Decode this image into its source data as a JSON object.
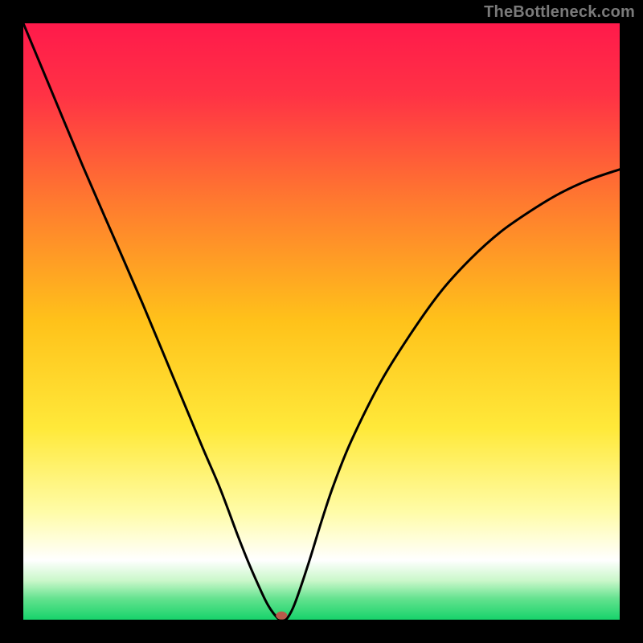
{
  "watermark": "TheBottleneck.com",
  "chart_data": {
    "type": "line",
    "title": "",
    "xlabel": "",
    "ylabel": "",
    "xlim": [
      0,
      100
    ],
    "ylim": [
      0,
      100
    ],
    "grid": false,
    "legend": false,
    "curve": {
      "description": "V-shaped bottleneck curve with minimum around x≈43; left branch steeper, right branch convex and shallower.",
      "x": [
        0,
        5,
        10,
        15,
        20,
        25,
        30,
        33,
        36,
        38,
        40,
        41,
        42,
        43,
        44,
        45,
        46,
        48,
        50,
        52,
        55,
        60,
        65,
        70,
        75,
        80,
        85,
        90,
        95,
        100
      ],
      "y": [
        100,
        88,
        76,
        64.5,
        53,
        41,
        29,
        22,
        14,
        9,
        4.5,
        2.5,
        1,
        0,
        0,
        1.5,
        4,
        10,
        16.5,
        22.5,
        30,
        40,
        48,
        55,
        60.5,
        65,
        68.5,
        71.5,
        73.8,
        75.5
      ]
    },
    "marker": {
      "x": 43.3,
      "y": 0.7,
      "color": "#b85a4a",
      "rx": 7,
      "ry": 5
    },
    "gradient_stops": [
      {
        "offset": 0.0,
        "color": "#ff1a4b"
      },
      {
        "offset": 0.12,
        "color": "#ff3245"
      },
      {
        "offset": 0.3,
        "color": "#ff7a2f"
      },
      {
        "offset": 0.5,
        "color": "#ffc21a"
      },
      {
        "offset": 0.68,
        "color": "#ffe93a"
      },
      {
        "offset": 0.82,
        "color": "#fffca8"
      },
      {
        "offset": 0.9,
        "color": "#ffffff"
      },
      {
        "offset": 0.935,
        "color": "#c9f7c9"
      },
      {
        "offset": 0.965,
        "color": "#63e28e"
      },
      {
        "offset": 1.0,
        "color": "#17d36b"
      }
    ]
  }
}
